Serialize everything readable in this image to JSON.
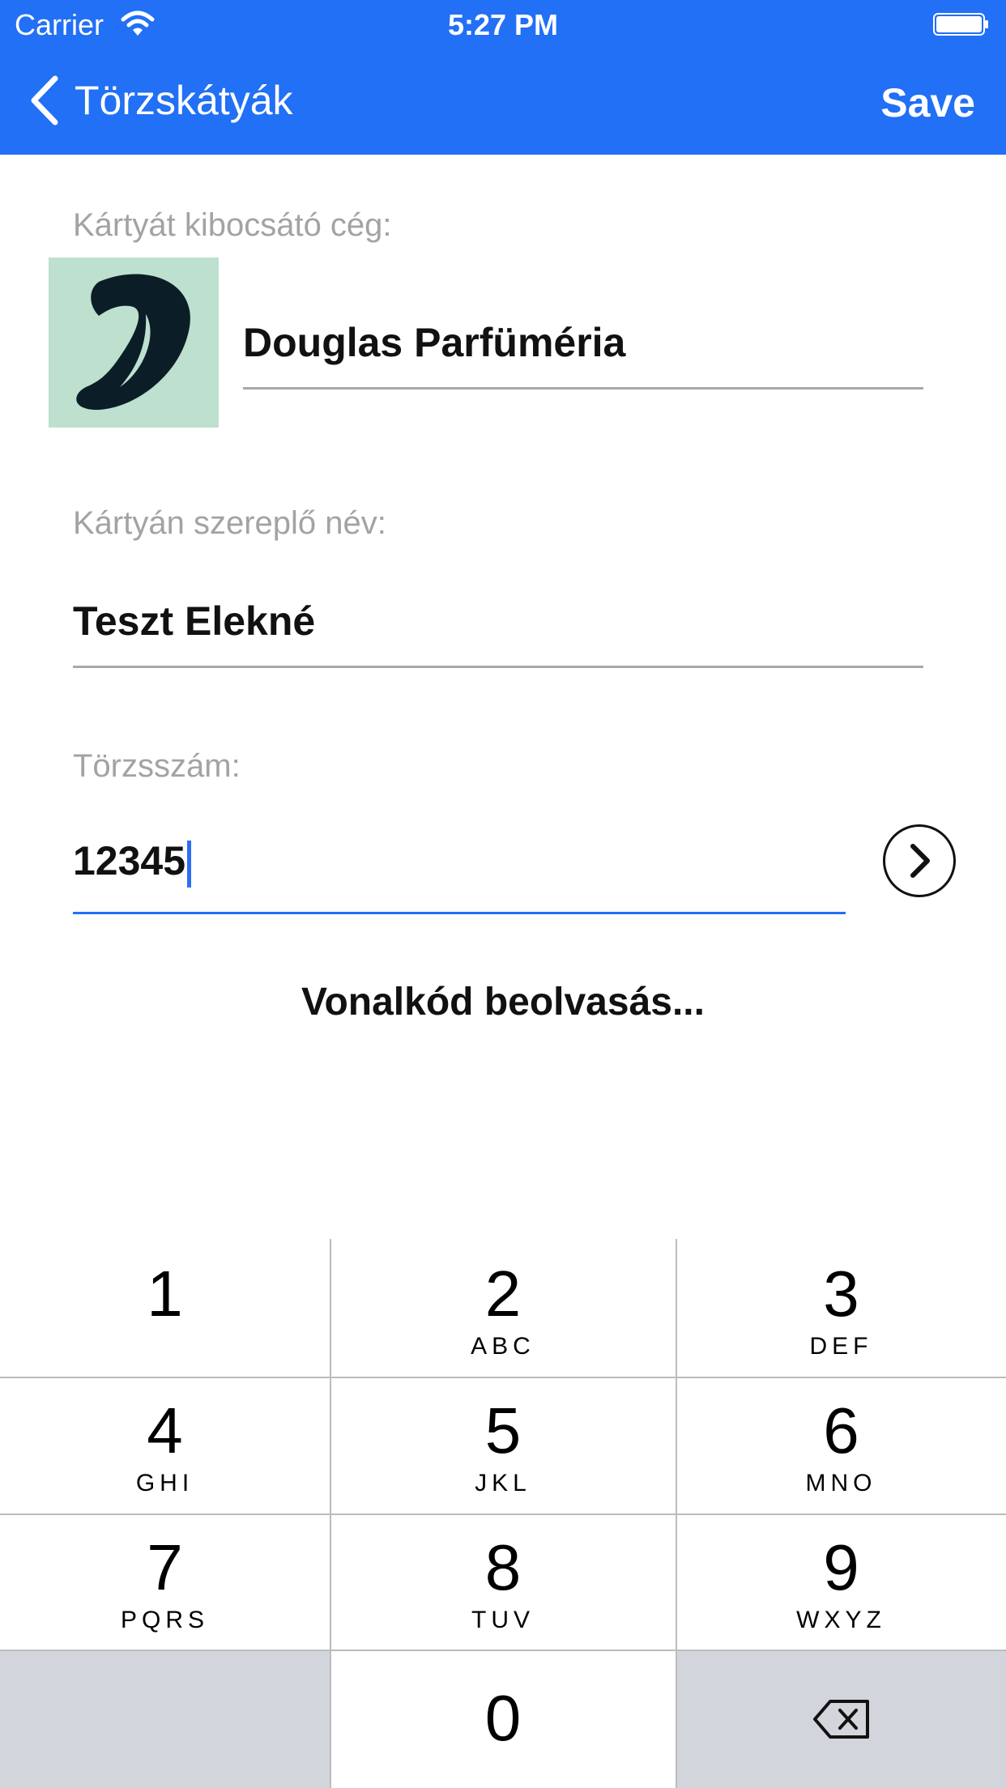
{
  "status_bar": {
    "carrier": "Carrier",
    "time": "5:27 PM"
  },
  "nav": {
    "back_label": "Törzskátyák",
    "save_label": "Save"
  },
  "form": {
    "issuer_label": "Kártyát kibocsátó cég:",
    "issuer_value": "Douglas Parfüméria",
    "name_label": "Kártyán szereplő név:",
    "name_value": "Teszt Elekné",
    "number_label": "Törzsszám:",
    "number_value": "12345",
    "scan_label": "Vonalkód beolvasás..."
  },
  "keypad": {
    "keys": [
      {
        "digit": "1",
        "letters": ""
      },
      {
        "digit": "2",
        "letters": "ABC"
      },
      {
        "digit": "3",
        "letters": "DEF"
      },
      {
        "digit": "4",
        "letters": "GHI"
      },
      {
        "digit": "5",
        "letters": "JKL"
      },
      {
        "digit": "6",
        "letters": "MNO"
      },
      {
        "digit": "7",
        "letters": "PQRS"
      },
      {
        "digit": "8",
        "letters": "TUV"
      },
      {
        "digit": "9",
        "letters": "WXYZ"
      },
      {
        "digit": "0",
        "letters": ""
      }
    ]
  },
  "colors": {
    "accent": "#2170f5",
    "keypad_gray": "#d2d5db",
    "label_gray": "#a3a3a3"
  },
  "icons": [
    "wifi-icon",
    "battery-icon",
    "chevron-left-icon",
    "chevron-right-icon",
    "backspace-icon",
    "douglas-logo"
  ]
}
